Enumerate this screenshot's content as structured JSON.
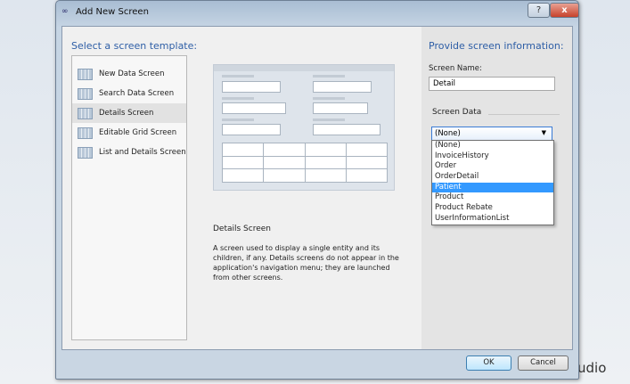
{
  "window": {
    "title": "Add New Screen",
    "help": "?",
    "close": "x"
  },
  "background": {
    "text": "udio"
  },
  "left": {
    "heading": "Select a screen template:",
    "templates": [
      {
        "label": "New Data Screen",
        "selected": false
      },
      {
        "label": "Search Data Screen",
        "selected": false
      },
      {
        "label": "Details Screen",
        "selected": true
      },
      {
        "label": "Editable Grid Screen",
        "selected": false
      },
      {
        "label": "List and Details Screen",
        "selected": false
      }
    ],
    "description_title": "Details Screen",
    "description": "A screen used to display a single entity and its children, if any.  Details screens do not appear in the application's navigation menu; they are launched from other screens."
  },
  "right": {
    "heading": "Provide screen information:",
    "screen_name_label": "Screen Name:",
    "screen_name_value": "Detail",
    "screen_data_label": "Screen Data",
    "selected": "(None)",
    "options": [
      "(None)",
      "InvoiceHistory",
      "Order",
      "OrderDetail",
      "Patient",
      "Product",
      "Product Rebate",
      "UserInformationList"
    ],
    "highlighted": "Patient"
  },
  "footer": {
    "ok": "OK",
    "cancel": "Cancel"
  },
  "colors": {
    "heading": "#2e5ea6",
    "highlight": "#3399ff"
  }
}
